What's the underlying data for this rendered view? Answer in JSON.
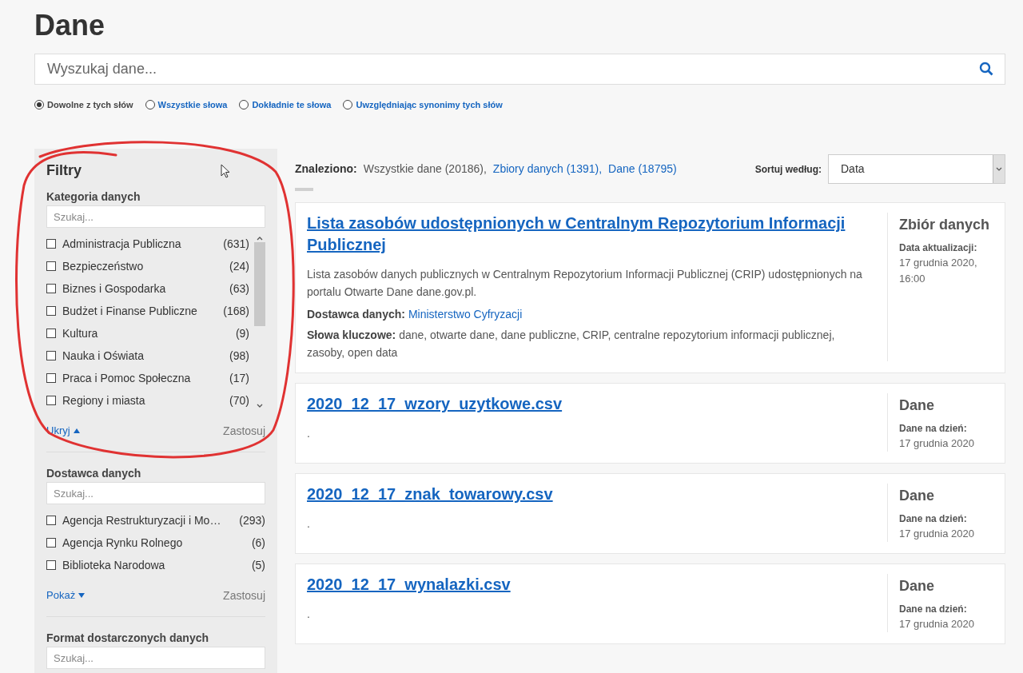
{
  "page": {
    "title": "Dane"
  },
  "search": {
    "placeholder": "Wyszukaj dane..."
  },
  "search_modes": [
    {
      "label": "Dowolne z tych słów",
      "selected": true
    },
    {
      "label": "Wszystkie słowa",
      "selected": false
    },
    {
      "label": "Dokładnie te słowa",
      "selected": false
    },
    {
      "label": "Uwzględniając synonimy tych słów",
      "selected": false
    }
  ],
  "filters": {
    "title": "Filtry",
    "sections": [
      {
        "title": "Kategoria danych",
        "search": {
          "placeholder": "Szukaj..."
        },
        "scrollable": true,
        "items": [
          {
            "label": "Administracja Publiczna",
            "count": "(631)",
            "checked": false
          },
          {
            "label": "Bezpieczeństwo",
            "count": "(24)",
            "checked": false
          },
          {
            "label": "Biznes i Gospodarka",
            "count": "(63)",
            "checked": false
          },
          {
            "label": "Budżet i Finanse Publiczne",
            "count": "(168)",
            "checked": false
          },
          {
            "label": "Kultura",
            "count": "(9)",
            "checked": false
          },
          {
            "label": "Nauka i Oświata",
            "count": "(98)",
            "checked": false
          },
          {
            "label": "Praca i Pomoc Społeczna",
            "count": "(17)",
            "checked": false
          },
          {
            "label": "Regiony i miasta",
            "count": "(70)",
            "checked": false
          }
        ],
        "toggle": {
          "label": "Ukryj",
          "expanded": true
        },
        "apply": "Zastosuj"
      },
      {
        "title": "Dostawca danych",
        "search": {
          "placeholder": "Szukaj..."
        },
        "scrollable": false,
        "items": [
          {
            "label": "Agencja Restrukturyzacji i Mo…",
            "count": "(293)",
            "checked": false
          },
          {
            "label": "Agencja Rynku Rolnego",
            "count": "(6)",
            "checked": false
          },
          {
            "label": "Biblioteka Narodowa",
            "count": "(5)",
            "checked": false
          }
        ],
        "toggle": {
          "label": "Pokaż",
          "expanded": false
        },
        "apply": "Zastosuj"
      },
      {
        "title": "Format dostarczonych danych",
        "search": {
          "placeholder": "Szukaj..."
        }
      }
    ]
  },
  "results": {
    "found_label": "Znaleziono:",
    "found": [
      {
        "text": "Wszystkie dane (20186),",
        "kind": "plain"
      },
      {
        "text": "Zbiory danych (1391),",
        "kind": "link"
      },
      {
        "text": "Dane (18795)",
        "kind": "link"
      }
    ],
    "sort": {
      "label": "Sortuj według:",
      "value": "Data"
    },
    "items": [
      {
        "title": "Lista zasobów udostępnionych w Centralnym Repozytorium Informacji Publicznej",
        "description": "Lista zasobów danych publicznych w Centralnym Repozytorium Informacji Publicznej (CRIP) udostępnionych na portalu Otwarte Dane dane.gov.pl.",
        "provider": {
          "label": "Dostawca danych:",
          "value": "Ministerstwo Cyfryzacji"
        },
        "keywords": {
          "label": "Słowa kluczowe:",
          "value": "dane, otwarte dane, dane publiczne, CRIP, centralne repozytorium informacji publicznej, zasoby, open data"
        },
        "type": "Zbiór danych",
        "date_label": "Data aktualizacji:",
        "date": "17 grudnia 2020, 16:00"
      },
      {
        "title": "2020_12_17_wzory_uzytkowe.csv",
        "description": ".",
        "type": "Dane",
        "date_label": "Dane na dzień:",
        "date": "17 grudnia 2020"
      },
      {
        "title": "2020_12_17_znak_towarowy.csv",
        "description": ".",
        "type": "Dane",
        "date_label": "Dane na dzień:",
        "date": "17 grudnia 2020"
      },
      {
        "title": "2020_12_17_wynalazki.csv",
        "description": ".",
        "type": "Dane",
        "date_label": "Dane na dzień:",
        "date": "17 grudnia 2020"
      }
    ]
  }
}
